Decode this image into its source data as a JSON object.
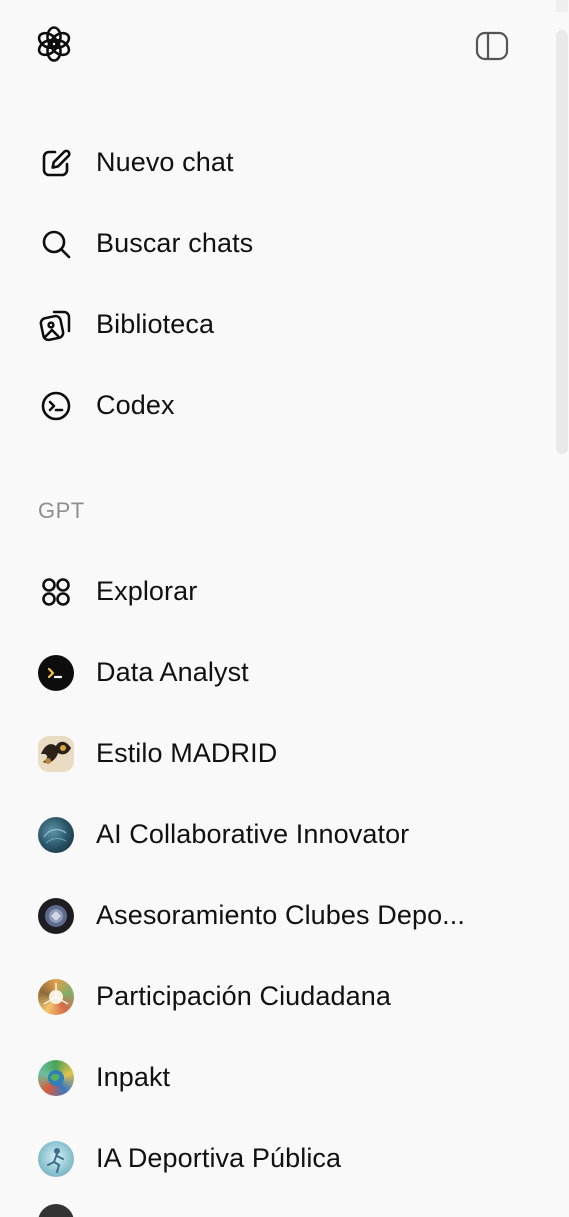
{
  "header": {
    "logo": "openai-logo-icon",
    "toggle": "sidebar-toggle-icon"
  },
  "nav": {
    "items": [
      {
        "label": "Nuevo chat",
        "icon": "edit-icon"
      },
      {
        "label": "Buscar chats",
        "icon": "search-icon"
      },
      {
        "label": "Biblioteca",
        "icon": "library-icon"
      },
      {
        "label": "Codex",
        "icon": "terminal-icon"
      }
    ]
  },
  "gpt_section": {
    "title": "GPT",
    "items": [
      {
        "label": "Explorar",
        "icon": "grid-icon"
      },
      {
        "label": "Data Analyst",
        "icon": "data-analyst-avatar"
      },
      {
        "label": "Estilo MADRID",
        "icon": "estilo-madrid-avatar"
      },
      {
        "label": "AI Collaborative Innovator",
        "icon": "ai-collab-avatar"
      },
      {
        "label": "Asesoramiento Clubes Depo...",
        "icon": "asesoramiento-avatar"
      },
      {
        "label": "Participación Ciudadana",
        "icon": "participacion-avatar"
      },
      {
        "label": "Inpakt",
        "icon": "inpakt-avatar"
      },
      {
        "label": "IA Deportiva Pública",
        "icon": "ia-deportiva-avatar"
      }
    ]
  },
  "colors": {
    "background": "#f9f9f9",
    "text": "#0d0d0d",
    "muted": "#8f8f8f"
  }
}
